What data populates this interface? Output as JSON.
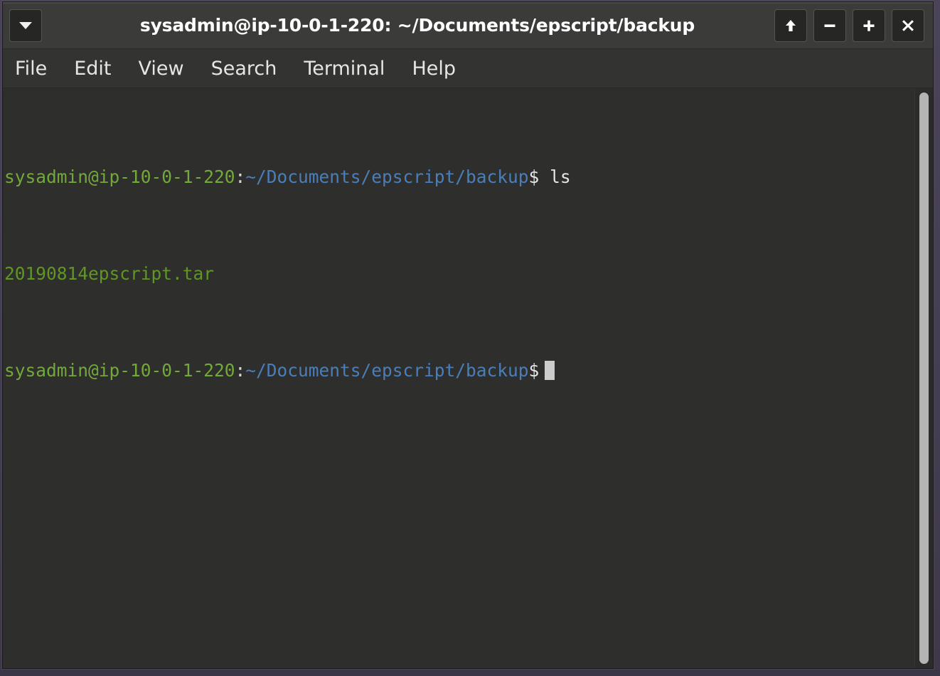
{
  "window": {
    "title": "sysadmin@ip-10-0-1-220: ~/Documents/epscript/backup",
    "menu_button_icon": "chevron-down-icon",
    "controls": [
      {
        "name": "shade-button",
        "icon": "up-arrow-icon",
        "label": "↑"
      },
      {
        "name": "minimize-button",
        "icon": "minus-icon",
        "label": "−"
      },
      {
        "name": "maximize-button",
        "icon": "plus-icon",
        "label": "+"
      },
      {
        "name": "close-button",
        "icon": "close-icon",
        "label": "×"
      }
    ]
  },
  "menubar": {
    "items": [
      {
        "label": "File"
      },
      {
        "label": "Edit"
      },
      {
        "label": "View"
      },
      {
        "label": "Search"
      },
      {
        "label": "Terminal"
      },
      {
        "label": "Help"
      }
    ]
  },
  "terminal": {
    "prompt": {
      "user_host": "sysadmin@ip-10-0-1-220",
      "separator": ":",
      "path": "~/Documents/epscript/backup",
      "symbol": "$"
    },
    "lines": [
      {
        "type": "prompt",
        "command": "ls"
      },
      {
        "type": "output",
        "text": "20190814epscript.tar"
      },
      {
        "type": "prompt",
        "command": "",
        "cursor": true
      }
    ],
    "command_1": "ls",
    "output_1": "20190814epscript.tar"
  },
  "scrollbar": {
    "name": "vertical-scrollbar",
    "thumb_position": "full"
  },
  "colors": {
    "prompt_user": "#73a83a",
    "prompt_path": "#4a7ebb",
    "output_file": "#5f9624",
    "terminal_bg": "#2e2e2c",
    "titlebar_bg": "#3b3b39",
    "menubar_bg": "#333331",
    "desktop_bg": "#4a4458"
  }
}
